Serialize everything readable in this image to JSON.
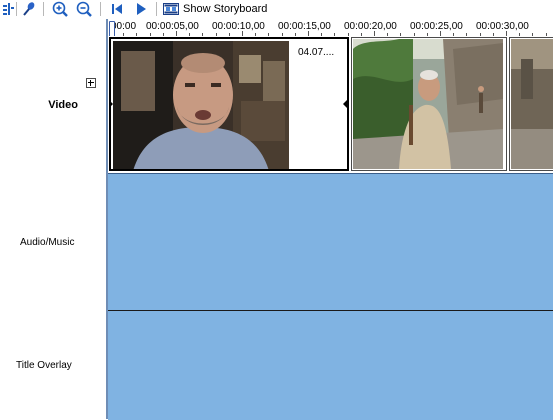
{
  "toolbar": {
    "show_storyboard_label": "Show Storyboard",
    "icons": [
      "timeline-options-icon",
      "narrate-microphone-icon",
      "zoom-in-icon",
      "zoom-out-icon",
      "rewind-icon",
      "play-icon",
      "storyboard-filmstrip-icon"
    ]
  },
  "tracks": {
    "video": "Video",
    "audio_music": "Audio/Music",
    "title_overlay": "Title Overlay"
  },
  "ruler": {
    "labels": [
      "00:00",
      "00:00:05,00",
      "00:00:10,00",
      "00:00:15,00",
      "00:00:20,00",
      "00:00:25,00",
      "00:00:30,00"
    ]
  },
  "clips": [
    {
      "name": "04.07....",
      "thumb": "man-face-indoors"
    },
    {
      "name": "",
      "thumb": "man-by-castle-wall"
    },
    {
      "name": "",
      "thumb": "stone-wall"
    }
  ],
  "colors": {
    "track_fill": "#80b3e2",
    "icon_blue": "#1f5fbf"
  }
}
